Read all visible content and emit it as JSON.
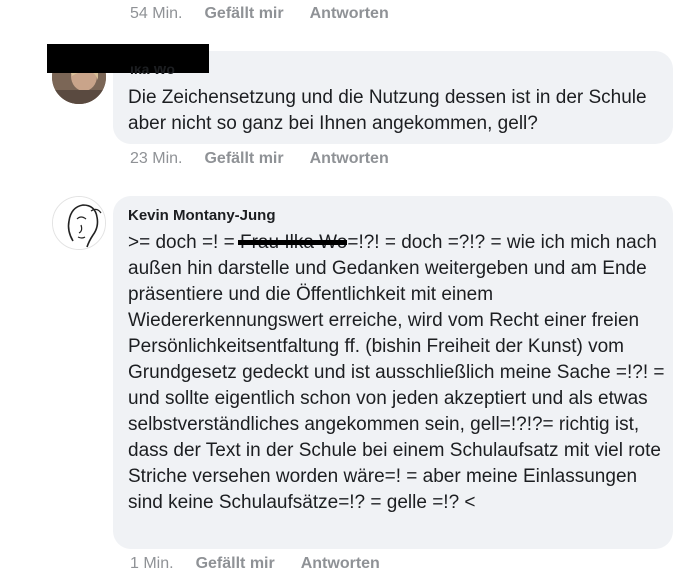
{
  "comments": [
    {
      "time": "54 Min.",
      "like": "Gefällt mir",
      "reply": "Antworten"
    },
    {
      "author_partial": "ika Wo",
      "text": "Die Zeichensetzung und die Nutzung dessen ist in der Schule aber nicht so ganz bei Ihnen angekommen, gell?",
      "time": "23 Min.",
      "like": "Gefällt mir",
      "reply": "Antworten"
    },
    {
      "author": "Kevin Montany-Jung",
      "text_before_redaction": ">= doch =! = ",
      "redacted_text": "Frau Ilka Wo",
      "text_after_redaction": "=!?! = doch =?!? = wie ich mich nach außen hin darstelle und Gedanken weitergeben und am Ende präsentiere und die Öffentlichkeit mit einem Wiedererkennungswert erreiche,  wird vom Recht einer freien Persönlichkeitsentfaltung ff. (bishin Freiheit der Kunst) vom Grundgesetz gedeckt und ist ausschließlich meine Sache =!?! = und sollte eigentlich schon von jeden akzeptiert und  als etwas selbstverständliches angekommen sein, gell=!?!?= richtig ist, dass der Text in der Schule bei einem Schulaufsatz mit  viel rote Striche versehen worden wäre=! = aber meine Einlassungen sind keine Schulaufsätze=!? = gelle =!? <",
      "time": "1 Min.",
      "like": "Gefällt mir",
      "reply": "Antworten"
    }
  ],
  "icons": {
    "avatar_1": "user-photo-avatar",
    "avatar_2": "line-drawing-face-avatar"
  },
  "colors": {
    "bubble_bg": "#f0f2f5",
    "meta_text": "#8f9296",
    "body_text": "#1c1e21",
    "redaction": "#000000"
  }
}
